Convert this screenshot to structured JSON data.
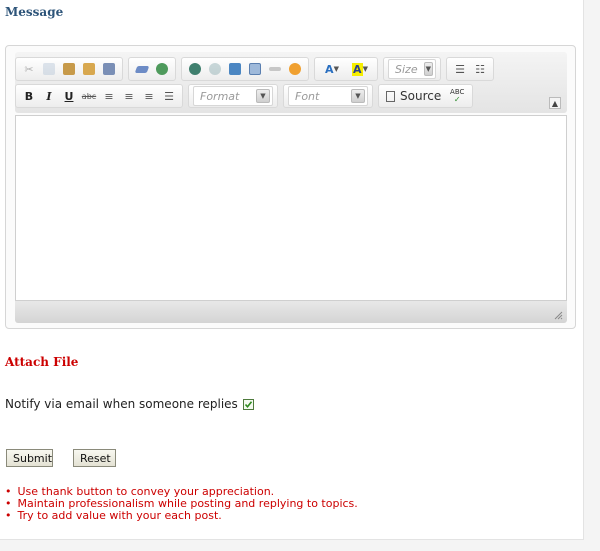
{
  "message_section": {
    "title": "Message"
  },
  "toolbar": {
    "size_label": "Size",
    "format_label": "Format",
    "font_label": "Font",
    "source_label": "Source",
    "spell_label": "ABC",
    "bold": "B",
    "italic": "I",
    "underline": "U",
    "strike": "abc",
    "font_color_label": "A",
    "bg_color_label": "A"
  },
  "attach": {
    "title": "Attach File"
  },
  "notify": {
    "label": "Notify via email when someone replies",
    "checked": true
  },
  "buttons": {
    "submit": "Submit",
    "reset": "Reset"
  },
  "tips": [
    "Use thank button to convey your appreciation.",
    "Maintain professionalism while posting and replying to topics.",
    "Try to add value with your each post."
  ],
  "colors": {
    "title_blue": "#2d5479",
    "accent_red": "#cc0000"
  }
}
